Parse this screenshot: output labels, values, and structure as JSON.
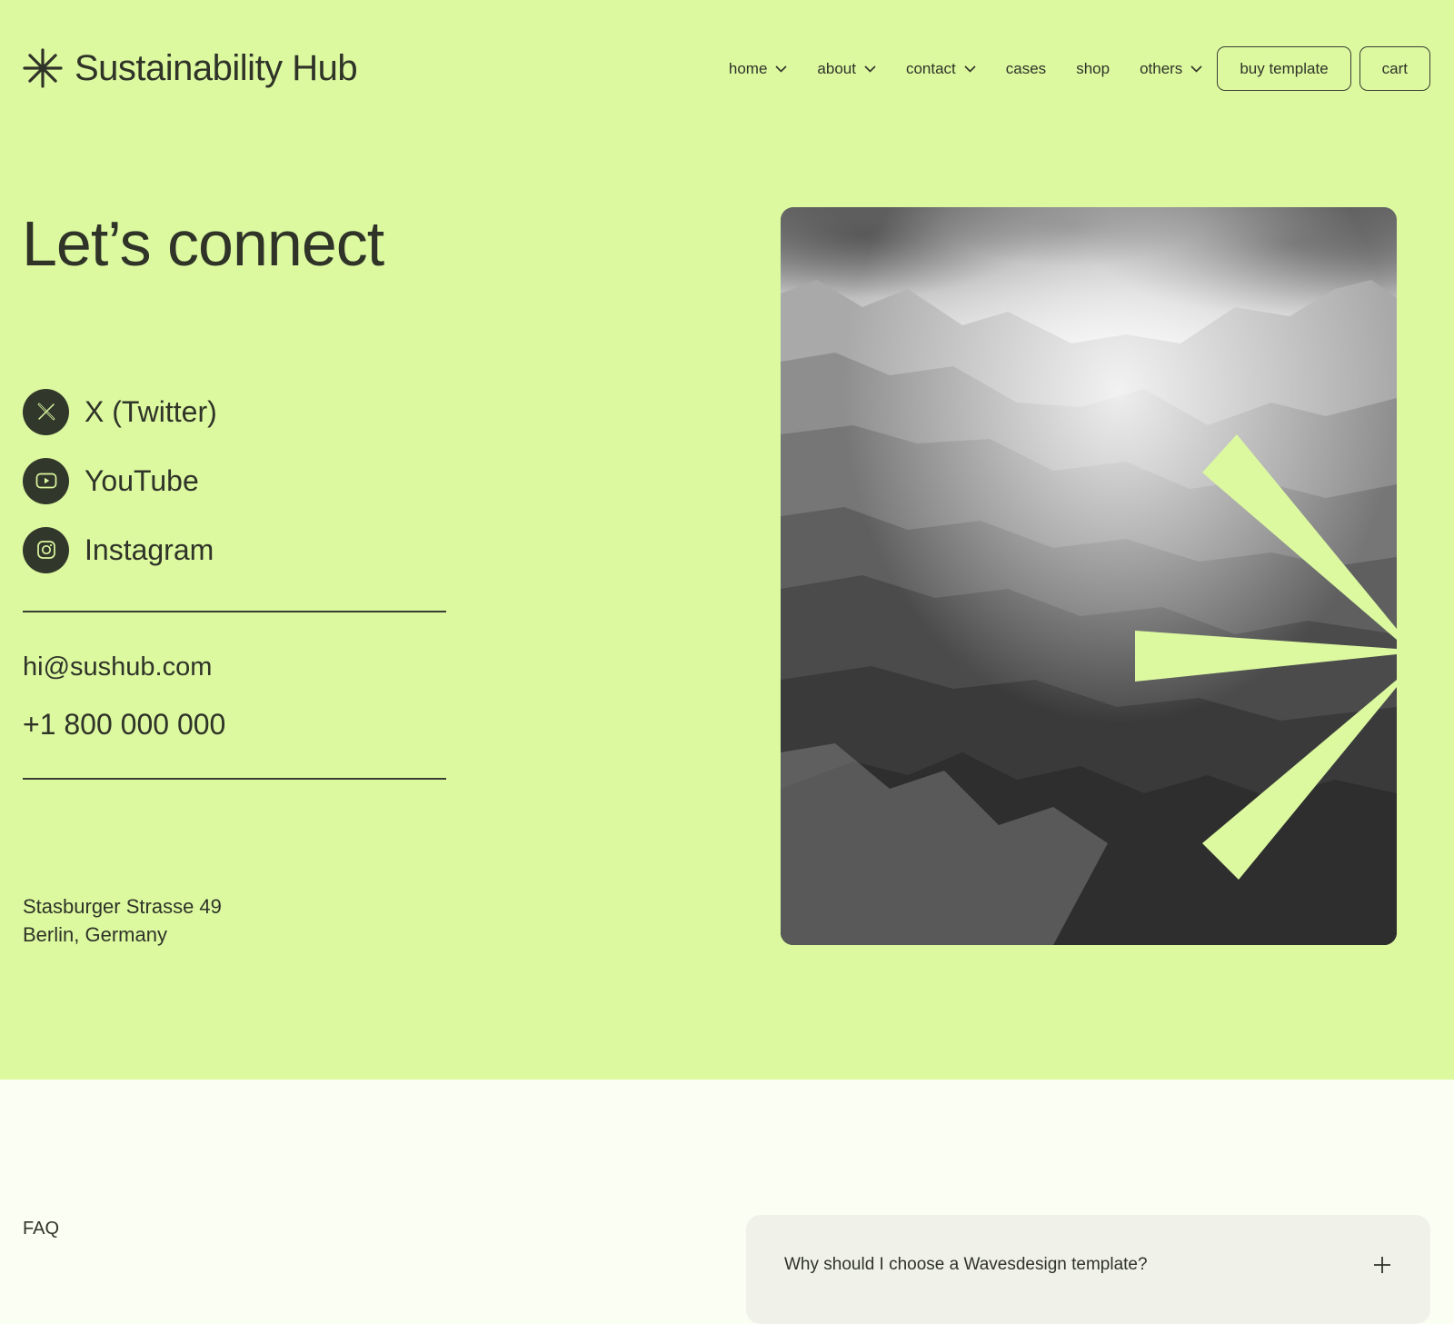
{
  "header": {
    "logo_text": "Sustainability Hub",
    "logo_icon": "asterisk-icon",
    "nav": [
      {
        "label": "home",
        "dropdown": true
      },
      {
        "label": "about",
        "dropdown": true
      },
      {
        "label": "contact",
        "dropdown": true
      },
      {
        "label": "cases",
        "dropdown": false
      },
      {
        "label": "shop",
        "dropdown": false
      },
      {
        "label": "others",
        "dropdown": true
      }
    ],
    "buy_label": "buy template",
    "cart_label": "cart"
  },
  "hero": {
    "title": "Let’s connect",
    "socials": [
      {
        "label": "X (Twitter)",
        "icon": "x-twitter-icon"
      },
      {
        "label": "YouTube",
        "icon": "youtube-icon"
      },
      {
        "label": "Instagram",
        "icon": "instagram-icon"
      }
    ],
    "email": "hi@sushub.com",
    "phone": "+1 800 000 000",
    "address_line1": "Stasburger Strasse 49",
    "address_line2": "Berlin, Germany",
    "image": "mountain-landscape-image"
  },
  "faq": {
    "label": "FAQ",
    "items": [
      {
        "question": "Why should I choose a Wavesdesign template?",
        "icon": "plus-icon"
      }
    ]
  },
  "colors": {
    "hero_background": "#dcf9a0",
    "page_background": "#fbfef3",
    "text": "#2f3328",
    "faq_card": "#f0f2e9"
  }
}
